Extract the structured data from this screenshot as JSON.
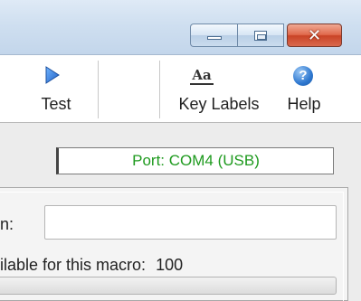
{
  "titlebar": {
    "buttons": {
      "minimize": "minimize",
      "maximize": "maximize",
      "close": "close"
    },
    "close_glyph": "✕"
  },
  "toolbar": {
    "test_label": "Test",
    "key_labels_label": "Key Labels",
    "key_labels_icon_text": "Aa",
    "help_label": "Help",
    "help_icon_text": "?"
  },
  "status": {
    "port": "Port: COM4 (USB)",
    "port_color": "#1e9a1e"
  },
  "macro": {
    "name_label_partial": "n:",
    "name_value": "",
    "available_label_partial": "ilable for this macro:",
    "available_value": "100"
  },
  "colors": {
    "close_button": "#c94326",
    "titlebar": "#cfdff0"
  }
}
